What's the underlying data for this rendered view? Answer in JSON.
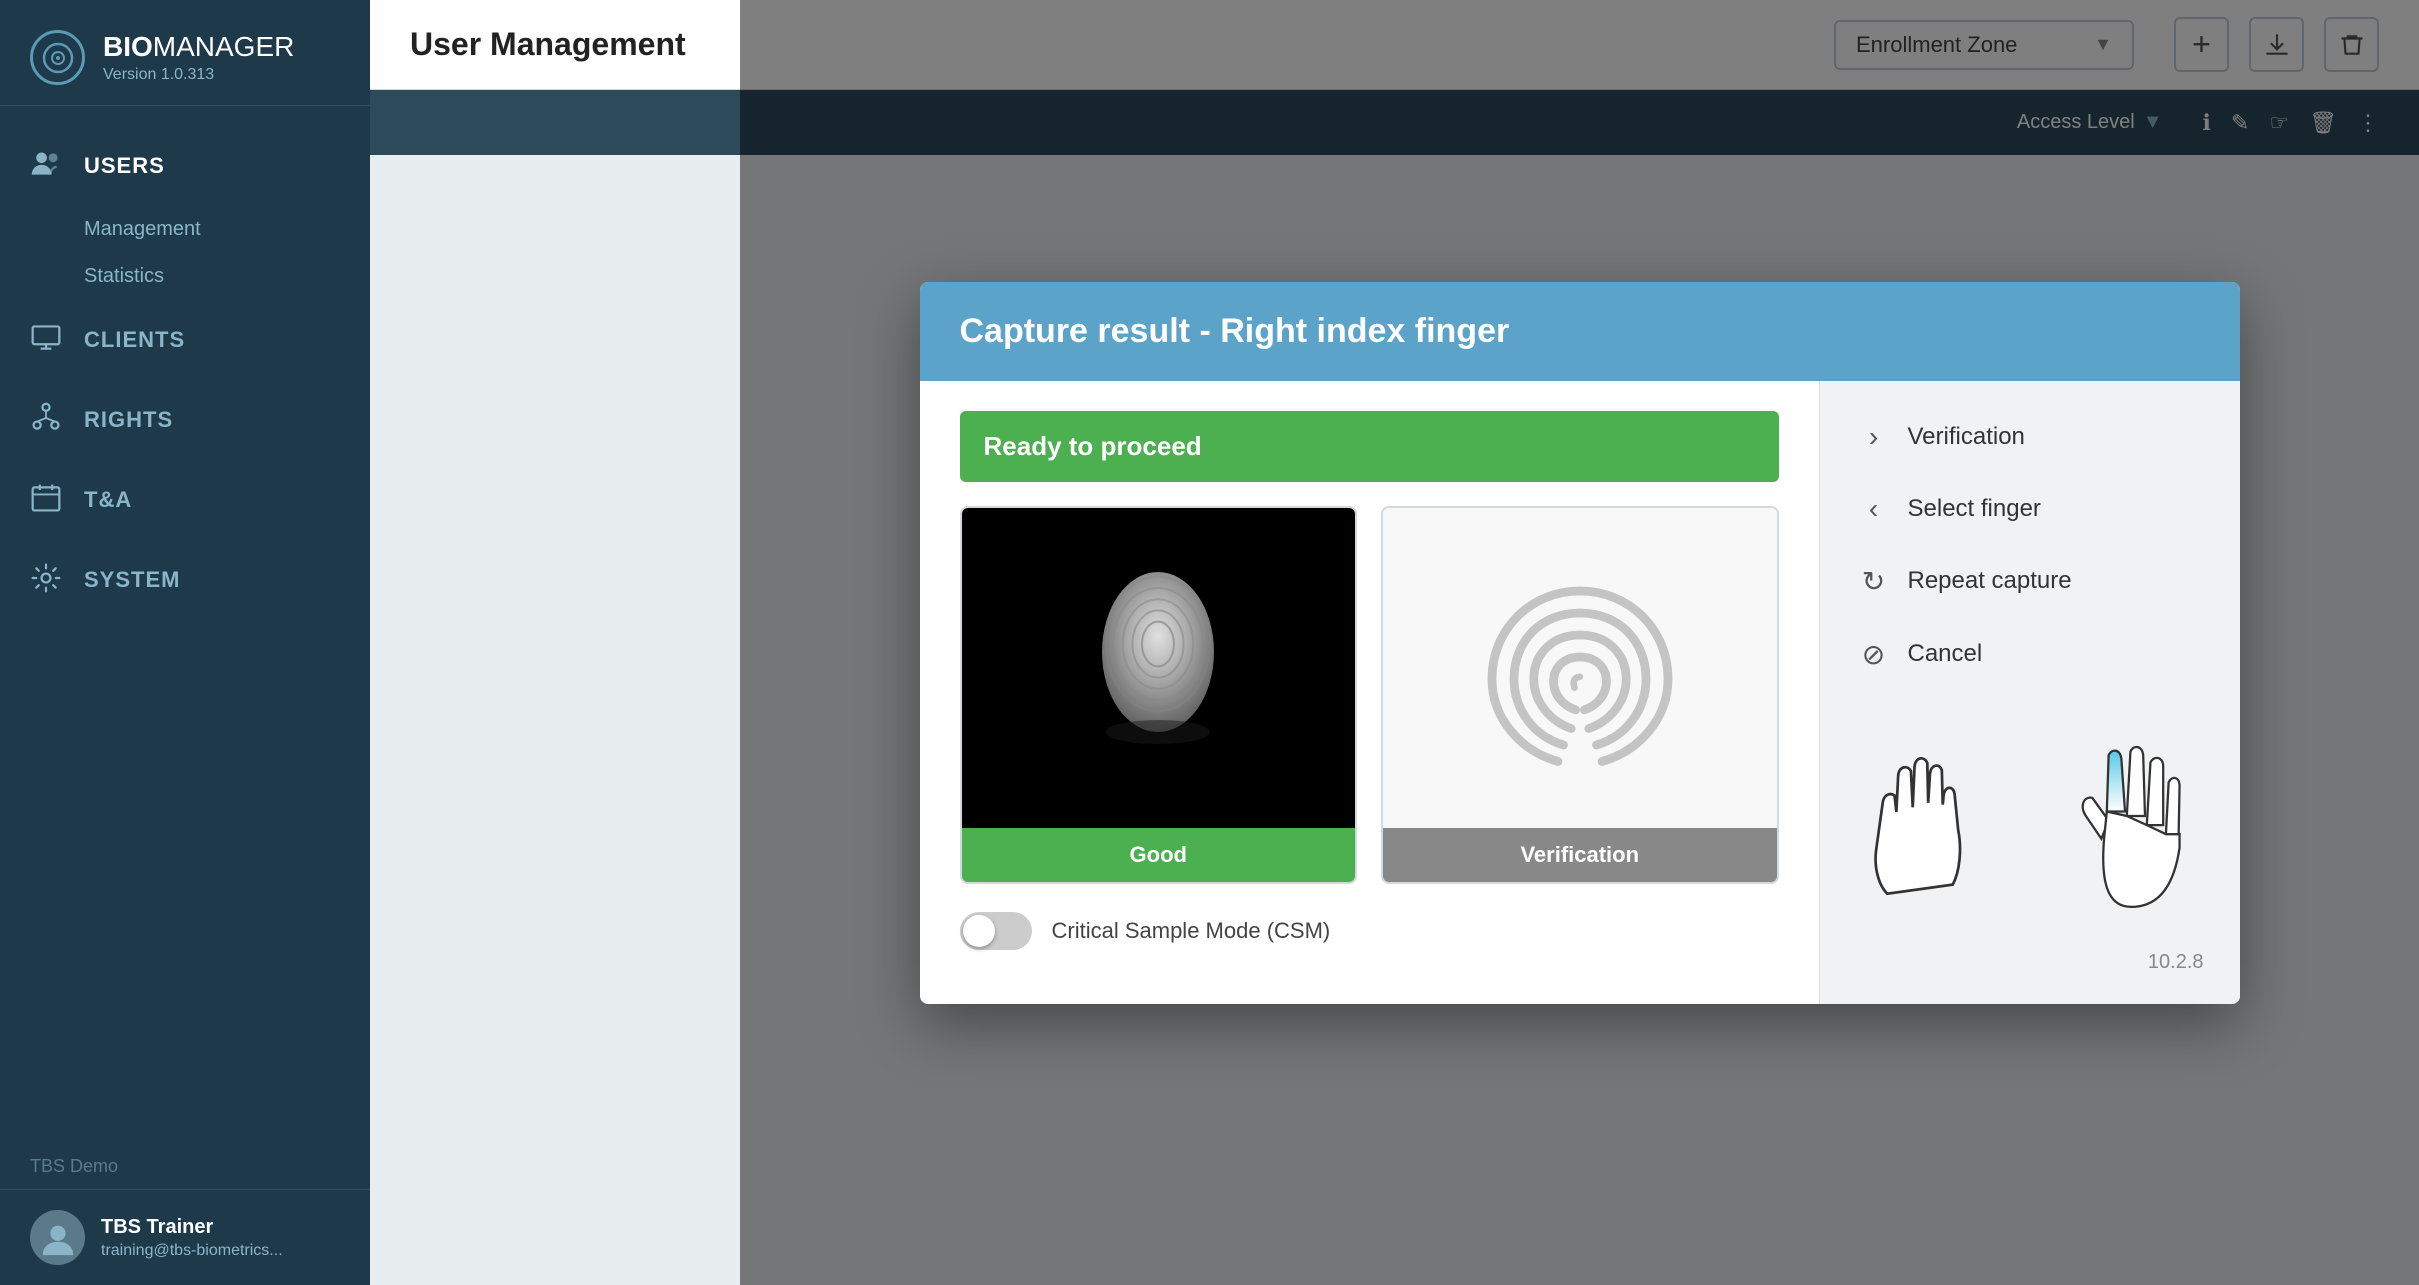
{
  "app": {
    "name_bold": "BIO",
    "name_light": "MANAGER",
    "version": "Version 1.0.313"
  },
  "sidebar": {
    "nav_items": [
      {
        "id": "users",
        "label": "USERS",
        "icon": "users"
      },
      {
        "id": "management",
        "label": "Management",
        "sub": true
      },
      {
        "id": "statistics",
        "label": "Statistics",
        "sub": true
      },
      {
        "id": "clients",
        "label": "CLIENTS",
        "icon": "monitor"
      },
      {
        "id": "rights",
        "label": "RIGHTS",
        "icon": "tree"
      },
      {
        "id": "ta",
        "label": "T&A",
        "icon": "calendar"
      },
      {
        "id": "system",
        "label": "SYSTEM",
        "icon": "gear"
      }
    ],
    "tenant": "TBS Demo",
    "user_name": "TBS Trainer",
    "user_email": "training@tbs-biometrics..."
  },
  "header": {
    "title": "User Management",
    "zone_label": "Enrollment Zone",
    "actions": [
      "add",
      "download",
      "delete"
    ]
  },
  "table": {
    "col_access": "Access Level"
  },
  "dialog": {
    "title": "Capture result - Right index finger",
    "status": "Ready to proceed",
    "status_color": "#4caf50",
    "capture_label": "Good",
    "verification_label": "Verification",
    "options": [
      {
        "id": "verification",
        "label": "Verification",
        "icon": "chevron-right"
      },
      {
        "id": "select-finger",
        "label": "Select finger",
        "icon": "chevron-left"
      },
      {
        "id": "repeat-capture",
        "label": "Repeat capture",
        "icon": "repeat"
      },
      {
        "id": "cancel",
        "label": "Cancel",
        "icon": "cancel"
      }
    ],
    "csm_label": "Critical Sample Mode (CSM)",
    "version": "10.2.8",
    "hands": {
      "left_label": "left hand",
      "right_label": "right hand",
      "highlighted_finger": "right index"
    }
  }
}
